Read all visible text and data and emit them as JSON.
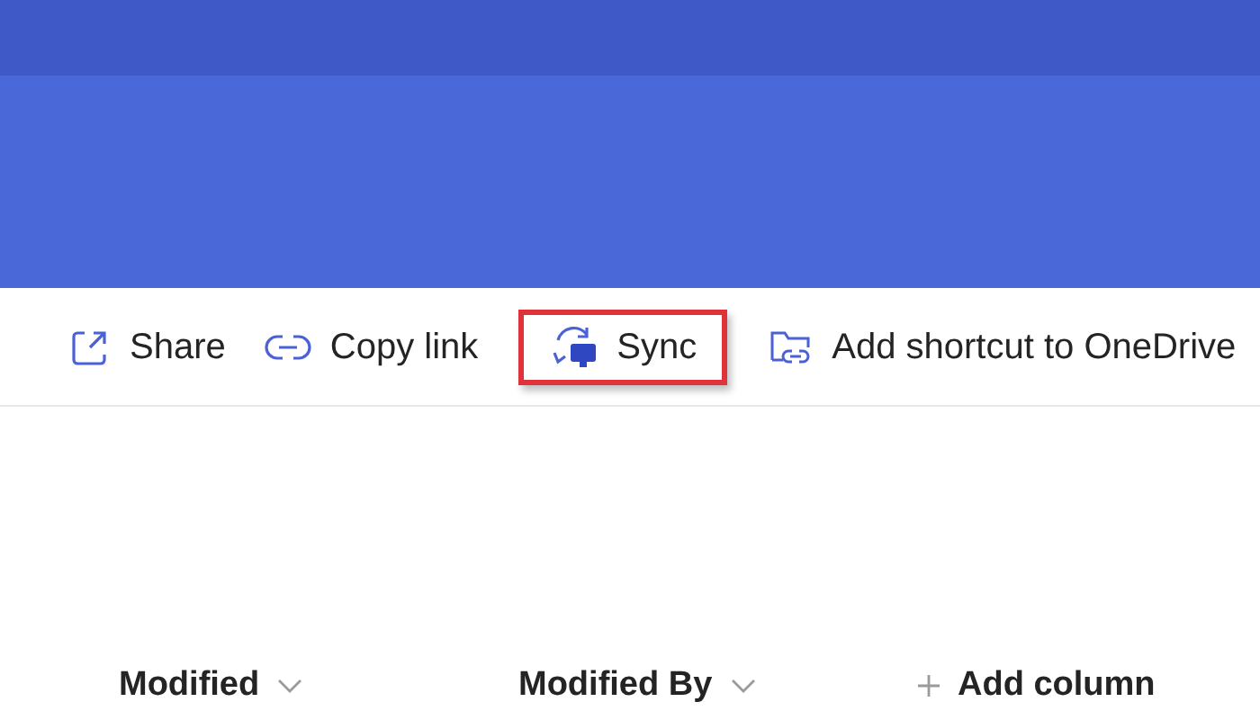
{
  "toolbar": [
    {
      "kind": "share",
      "label": "Share",
      "highlighted": false
    },
    {
      "kind": "link",
      "label": "Copy link",
      "highlighted": false
    },
    {
      "kind": "sync",
      "label": "Sync",
      "highlighted": true
    },
    {
      "kind": "shortcut",
      "label": "Add shortcut to OneDrive",
      "highlighted": false
    }
  ],
  "columns": [
    {
      "kind": "sort",
      "label": "Modified"
    },
    {
      "kind": "sort",
      "label": "Modified By"
    },
    {
      "kind": "add",
      "label": "Add column"
    }
  ]
}
